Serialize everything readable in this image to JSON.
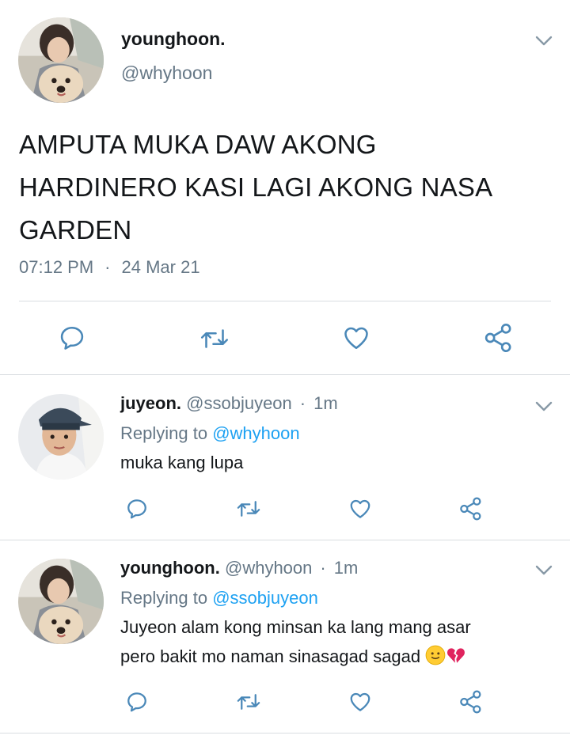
{
  "main_tweet": {
    "display_name": "younghoon.",
    "handle": "@whyhoon",
    "text": "AMPUTA MUKA DAW AKONG HARDINERO KASI LAGI AKONG NASA GARDEN",
    "time": "07:12 PM",
    "separator": "·",
    "date": "24 Mar 21"
  },
  "replies": [
    {
      "display_name": "juyeon.",
      "handle": "@ssobjuyeon",
      "separator": "·",
      "time_ago": "1m",
      "replying_label": "Replying to",
      "replying_to": "@whyhoon",
      "text": "muka kang lupa"
    },
    {
      "display_name": "younghoon.",
      "handle": "@whyhoon",
      "separator": "·",
      "time_ago": "1m",
      "replying_label": "Replying to",
      "replying_to": "@ssobjuyeon",
      "text_line1": "Juyeon alam kong minsan ka lang mang asar",
      "text_line2": "pero bakit mo naman sinasagad sagad"
    }
  ],
  "icons": {
    "more": "chevron-down-icon",
    "reply": "reply-icon",
    "retweet": "retweet-icon",
    "like": "heart-icon",
    "share": "share-icon",
    "emoji_1": "slightly-smiling-face-emoji",
    "emoji_2": "broken-heart-emoji"
  },
  "colors": {
    "text": "#14171a",
    "secondary": "#657786",
    "link": "#1da1f2",
    "divider": "#d9dde1"
  }
}
